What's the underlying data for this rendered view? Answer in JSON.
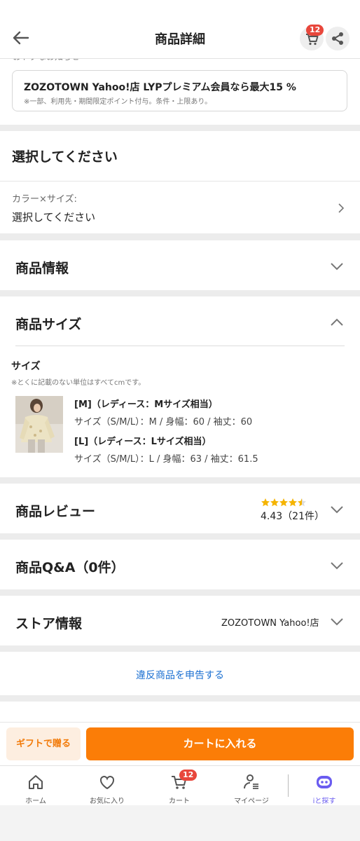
{
  "header": {
    "title": "商品詳細",
    "cart_count": "12"
  },
  "promo": {
    "notice_label": "おトクなお知らせ",
    "title": "ZOZOTOWN Yahoo!店 LYPプレミアム会員なら最大15 %",
    "note": "※一部、利用先・期間限定ポイント付与。条件・上限あり。"
  },
  "selection": {
    "heading": "選択してください",
    "option_label": "カラー×サイズ:",
    "option_value": "選択してください"
  },
  "sections": {
    "product_info": "商品情報",
    "product_size": "商品サイズ",
    "review": "商品レビュー",
    "qa": "商品Q&A（0件）",
    "store": "ストア情報"
  },
  "size": {
    "heading": "サイズ",
    "note": "※とくに記載のない単位はすべてcmです。",
    "rows": [
      {
        "title": "[M]（レディース：Mサイズ相当）",
        "detail": "サイズ（S/M/L）：M / 身幅：60 / 袖丈：60"
      },
      {
        "title": "[L]（レディース：Lサイズ相当）",
        "detail": "サイズ（S/M/L）：L / 身幅：63 / 袖丈：61.5"
      }
    ]
  },
  "review": {
    "stars": 4.43,
    "summary": "4.43（21件）"
  },
  "store": {
    "name": "ZOZOTOWN Yahoo!店"
  },
  "report_link": "違反商品を申告する",
  "cta": {
    "gift": "ギフトで贈る",
    "add_to_cart": "カートに入れる"
  },
  "tabs": [
    {
      "label": "ホーム"
    },
    {
      "label": "お気に入り"
    },
    {
      "label": "カート",
      "badge": "12"
    },
    {
      "label": "マイページ"
    },
    {
      "label": "iと探す"
    }
  ],
  "colors": {
    "accent": "#fb7d07",
    "link": "#1a6fd1",
    "badge": "#e8473c",
    "star": "#f5b400"
  }
}
